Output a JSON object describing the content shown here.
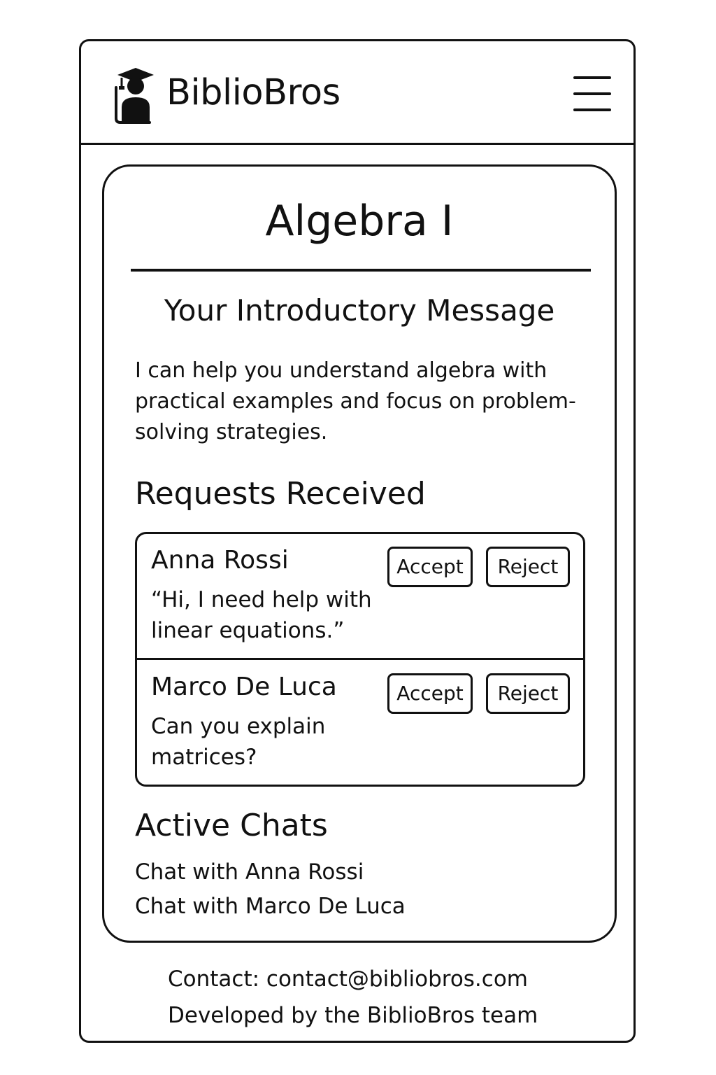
{
  "header": {
    "brand": "BiblioBros",
    "logo_icon": "graduate-book-icon",
    "menu_icon": "hamburger-menu-icon"
  },
  "course": {
    "title": "Algebra I"
  },
  "intro": {
    "heading": "Your Introductory Message",
    "text": "I can help you understand algebra with practical examples and focus on problem-solving strategies."
  },
  "requests": {
    "heading": "Requests Received",
    "items": [
      {
        "name": "Anna Rossi",
        "message": "“Hi, I need help with linear equations.”",
        "accept_label": "Accept",
        "reject_label": "Reject"
      },
      {
        "name": "Marco De Luca",
        "message": "Can you explain matrices?",
        "accept_label": "Accept",
        "reject_label": "Reject"
      }
    ]
  },
  "active_chats": {
    "heading": "Active Chats",
    "items": [
      "Chat with Anna Rossi",
      "Chat with Marco De Luca"
    ]
  },
  "footer": {
    "contact": "Contact: contact@bibliobros.com",
    "credit": "Developed by the BiblioBros team"
  }
}
